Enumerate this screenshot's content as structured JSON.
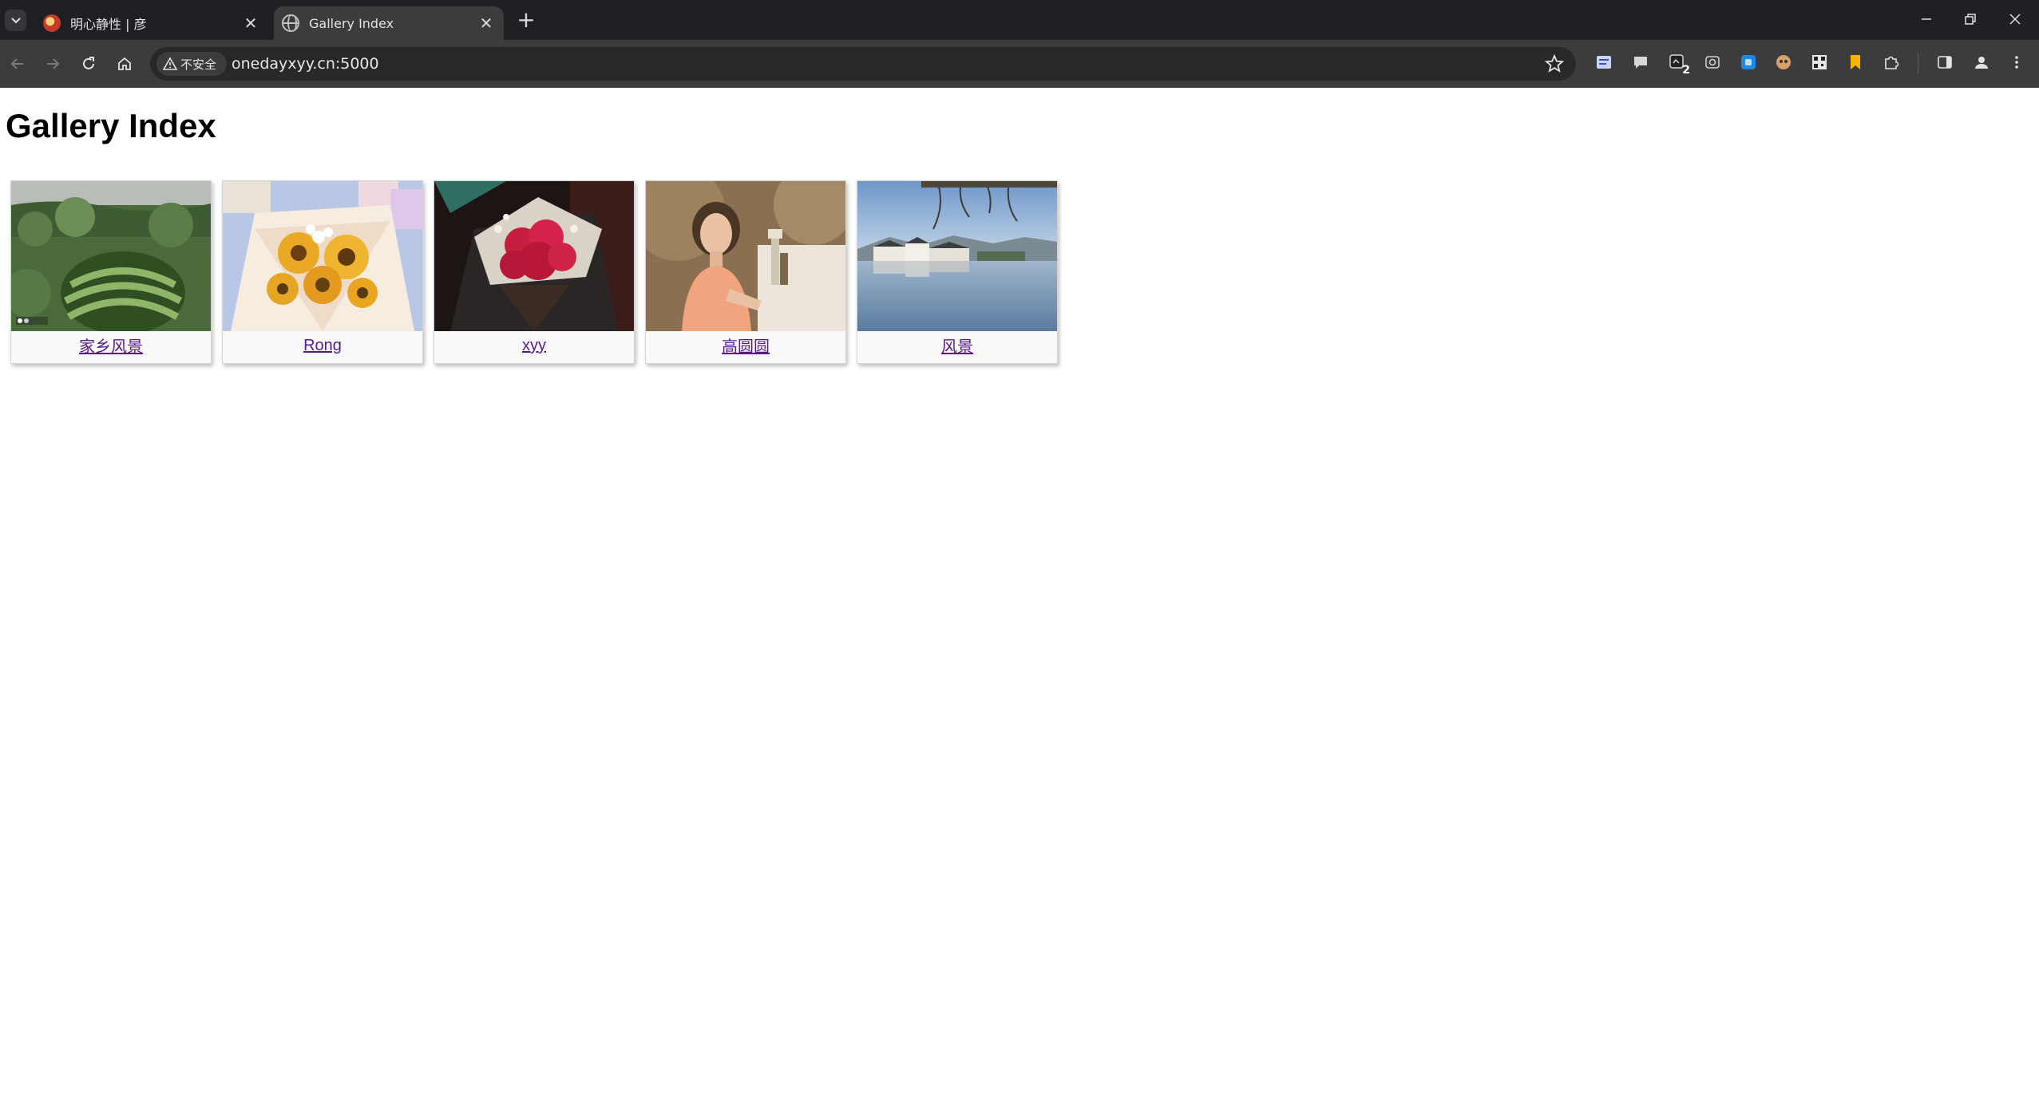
{
  "browser": {
    "tabs": [
      {
        "title": "明心静性 | 彦",
        "active": false
      },
      {
        "title": "Gallery Index",
        "active": true
      }
    ],
    "address_bar": {
      "security_label": "不安全",
      "url": "onedayxyy.cn:5000"
    },
    "extension_badge": "2"
  },
  "page": {
    "title": "Gallery Index",
    "galleries": [
      {
        "label": "家乡风景",
        "thumbnail": "watermelon-photo"
      },
      {
        "label": "Rong",
        "thumbnail": "sunflower-bouquet-photo"
      },
      {
        "label": "xyy",
        "thumbnail": "red-rose-bouquet-photo"
      },
      {
        "label": "高圆圆",
        "thumbnail": "portrait-photo"
      },
      {
        "label": "风景",
        "thumbnail": "lake-village-photo"
      }
    ]
  },
  "colors": {
    "tabstrip": "#1f2023",
    "toolbar": "#3c3c3c",
    "omnibox": "#282828",
    "visited_link": "#551a8b"
  }
}
